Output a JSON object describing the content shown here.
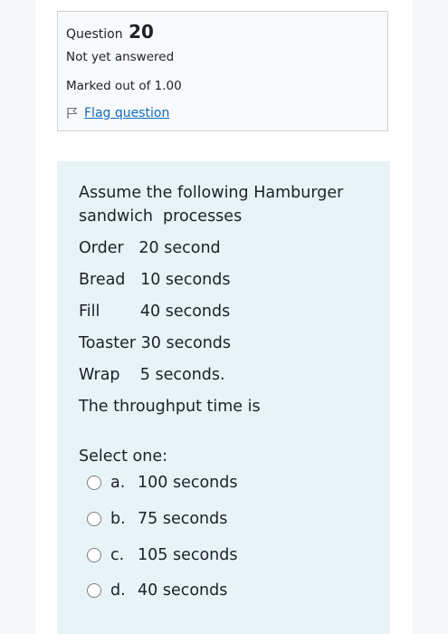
{
  "info": {
    "question_word": "Question",
    "question_number": "20",
    "status": "Not yet answered",
    "marked": "Marked out of 1.00",
    "flag_label": "Flag question"
  },
  "question": {
    "lines": [
      "Assume the following Hamburger",
      "sandwich  processes",
      "Order   20 second",
      "Bread   10 seconds",
      "Fill        40 seconds",
      "Toaster 30 seconds",
      "Wrap    5 seconds.",
      "The throughput time is"
    ],
    "select_prompt": "Select one:",
    "options": [
      {
        "letter": "a.",
        "text": "100 seconds"
      },
      {
        "letter": "b.",
        "text": "75 seconds"
      },
      {
        "letter": "c.",
        "text": "105 seconds"
      },
      {
        "letter": "d.",
        "text": "40 seconds"
      }
    ]
  }
}
